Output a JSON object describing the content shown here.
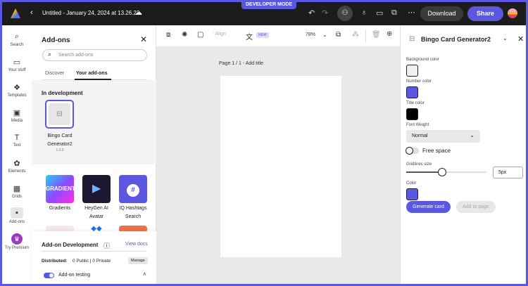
{
  "header": {
    "dev_mode": "DEVELOPER MODE",
    "doc_title": "Untitled - January 24, 2024 at 13.26.22",
    "download": "Download",
    "share": "Share"
  },
  "rail": [
    {
      "label": "Search",
      "icon": "⌕"
    },
    {
      "label": "Your stuff",
      "icon": "▭"
    },
    {
      "label": "Templates",
      "icon": "❖"
    },
    {
      "label": "Media",
      "icon": "▣"
    },
    {
      "label": "Text",
      "icon": "T"
    },
    {
      "label": "Elements",
      "icon": "✿"
    },
    {
      "label": "Grids",
      "icon": "▦"
    },
    {
      "label": "Add-ons",
      "icon": "▪"
    },
    {
      "label": "Try Premium",
      "icon": "♛"
    }
  ],
  "addons": {
    "title": "Add-ons",
    "search_placeholder": "Search add-ons",
    "tabs": [
      "Discover",
      "Your add-ons"
    ],
    "in_dev": "In development",
    "dev_card": {
      "name_line1": "Bingo Card",
      "name_line2": "Generator2",
      "version": "1.0.0"
    },
    "apps": [
      {
        "l1": "Gradients",
        "l2": "",
        "text": "GRADIENTS"
      },
      {
        "l1": "HeyGen AI",
        "l2": "Avatar",
        "text": ""
      },
      {
        "l1": "IQ Hashtags",
        "l2": "Search",
        "text": "#"
      }
    ],
    "dev_footer": {
      "title": "Add-on Development",
      "view_docs": "View docs",
      "distributed_label": "Distributed:",
      "distributed_value": "0 Public | 0 Private",
      "manage": "Manage",
      "testing": "Add-on testing"
    }
  },
  "toolbar": {
    "align": "Align",
    "new_badge": "NEW",
    "zoom": "78%"
  },
  "canvas": {
    "page_label": "Page 1 / 1 - Add title"
  },
  "plugin": {
    "title": "Bingo Card Generator2",
    "bg_label": "Background color",
    "bg_color": "#f0f0f0",
    "num_label": "Number color",
    "num_color": "#5a57e0",
    "title_label": "Title color",
    "title_color": "#000000",
    "fw_label": "Font Weight",
    "fw_value": "Normal",
    "free_space": "Free space",
    "free_space_on": false,
    "grid_label": "Gridlines size",
    "grid_value": "5px",
    "grid_slider_percent": 45,
    "color_label": "Color",
    "color": "#5a57e0",
    "generate": "Generate card",
    "add": "Add to page"
  }
}
